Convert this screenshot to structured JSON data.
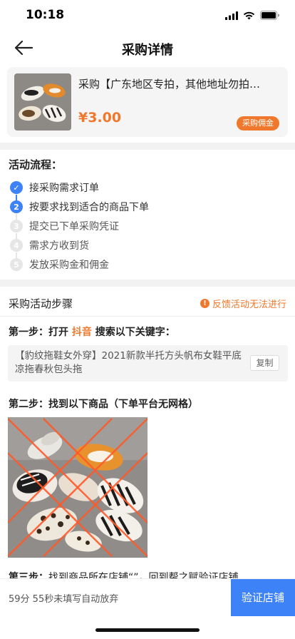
{
  "status_bar": {
    "time": "10:18"
  },
  "nav": {
    "title": "采购详情"
  },
  "product": {
    "title": "采购【广东地区专拍，其他地址勿拍…",
    "price": "¥3.00",
    "badge": "采购佣金"
  },
  "flow": {
    "title": "活动流程：",
    "steps": [
      {
        "label": "接采购需求订单",
        "num": "✓",
        "state": "done"
      },
      {
        "label": "按要求找到适合的商品下单",
        "num": "2",
        "state": "active"
      },
      {
        "label": "提交已下单采购凭证",
        "num": "3",
        "state": "pending"
      },
      {
        "label": "需求方收到货",
        "num": "4",
        "state": "pending"
      },
      {
        "label": "发放采购金和佣金",
        "num": "5",
        "state": "pending"
      }
    ]
  },
  "section": {
    "title": "采购活动步骤",
    "report_label": "反馈活动无法进行",
    "report_icon": "!"
  },
  "step1": {
    "prefix": "第一步：打开",
    "app": "抖音",
    "suffix": "搜索以下关键字：",
    "keyword": "【豹纹拖鞋女外穿】2021新款半托方头帆布女鞋平底凉拖春秋包头拖",
    "copy_label": "复制"
  },
  "step2": {
    "text": "第二步：找到以下商品（下单平台无网格）"
  },
  "step3": {
    "prefix": "第三步：",
    "text": "找到商品所在店铺“”，回到帮之赋验证店铺"
  },
  "bottom": {
    "countdown": "59分 55秒未填写自动放弃",
    "verify_label": "验证店铺"
  },
  "colors": {
    "accent": "#f0782c",
    "primary": "#3e82f7"
  }
}
